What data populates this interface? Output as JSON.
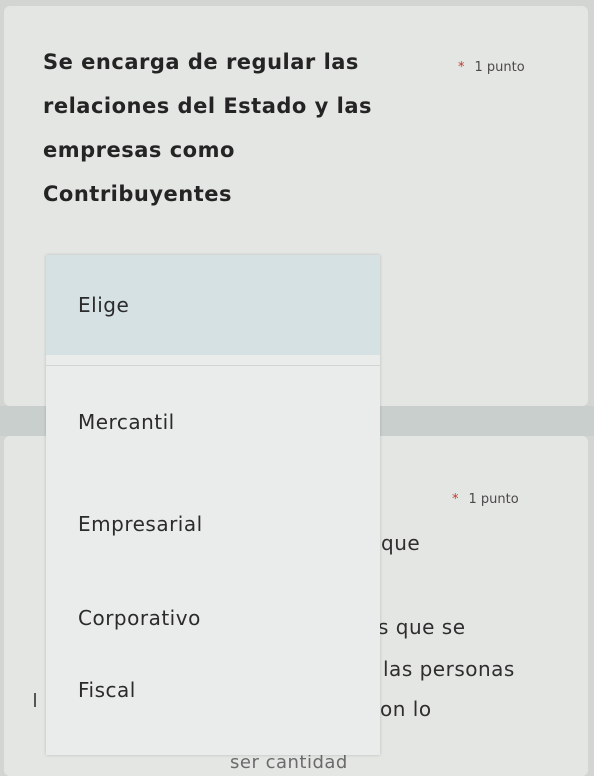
{
  "question_1": {
    "title_lines": [
      "Se encarga de regular las",
      "relaciones del Estado y las",
      "empresas como",
      "Contribuyentes"
    ],
    "required_marker": "*",
    "points": "1 punto"
  },
  "dropdown": {
    "selected_placeholder": "Elige",
    "options": [
      "Mercantil",
      "Empresarial",
      "Corporativo",
      "Fiscal"
    ]
  },
  "question_2": {
    "required_marker": "*",
    "points": "1 punto",
    "visible_fragments": [
      "que",
      "s que se",
      "las personas",
      "on lo",
      "ser cantidad"
    ]
  }
}
